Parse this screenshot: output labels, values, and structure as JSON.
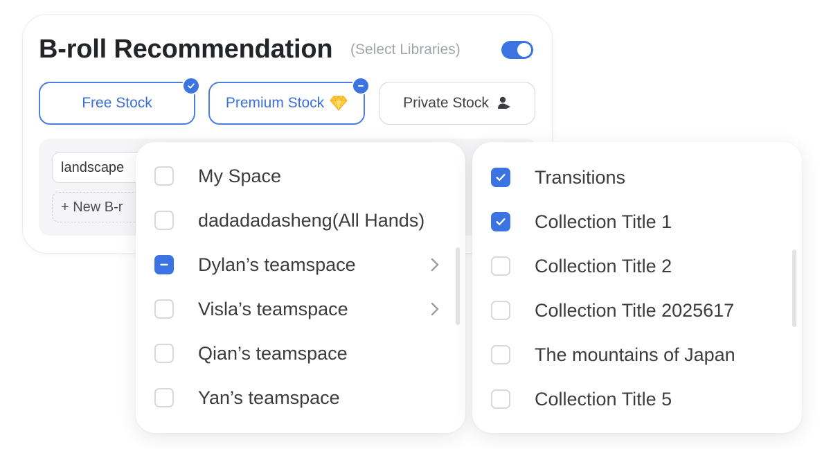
{
  "header": {
    "title": "B-roll Recommendation",
    "subtitle": "(Select Libraries)",
    "toggle_on": true
  },
  "stock_buttons": [
    {
      "label": "Free Stock",
      "state": "checked"
    },
    {
      "label": "Premium Stock",
      "state": "partial",
      "icon": "diamond-icon"
    },
    {
      "label": "Private Stock",
      "state": "unselected",
      "icon": "person-video-icon"
    }
  ],
  "keywords": {
    "chip_label": "landscape",
    "new_label": "+ New B-r"
  },
  "spaces": [
    {
      "label": "My Space",
      "state": "unchecked",
      "has_children": false
    },
    {
      "label": "dadadadasheng(All Hands)",
      "state": "unchecked",
      "has_children": false
    },
    {
      "label": "Dylan’s teamspace",
      "state": "partial",
      "has_children": true
    },
    {
      "label": "Visla’s teamspace",
      "state": "unchecked",
      "has_children": true
    },
    {
      "label": "Qian’s teamspace",
      "state": "unchecked",
      "has_children": false
    },
    {
      "label": "Yan’s teamspace",
      "state": "unchecked",
      "has_children": false
    }
  ],
  "collections": [
    {
      "label": "Transitions",
      "state": "checked"
    },
    {
      "label": "Collection Title 1",
      "state": "checked"
    },
    {
      "label": "Collection Title 2",
      "state": "unchecked"
    },
    {
      "label": "Collection Title 2025617",
      "state": "unchecked"
    },
    {
      "label": "The mountains of Japan",
      "state": "unchecked"
    },
    {
      "label": "Collection Title 5",
      "state": "unchecked"
    }
  ],
  "colors": {
    "accent": "#3b73e3",
    "text": "#3a3c40",
    "muted": "#a2a5ab"
  }
}
